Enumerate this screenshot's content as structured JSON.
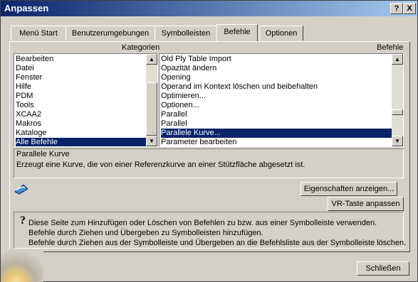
{
  "window": {
    "title": "Anpassen",
    "help_btn": "?",
    "close_btn": "X"
  },
  "tabs": [
    {
      "label": "Menü Start"
    },
    {
      "label": "Benutzerumgebungen"
    },
    {
      "label": "Symbolleisten"
    },
    {
      "label": "Befehle",
      "active": true
    },
    {
      "label": "Optionen"
    }
  ],
  "categories": {
    "header": "Kategorien",
    "items": [
      "Bearbeiten",
      "Datei",
      "Fenster",
      "Hilfe",
      "PDM",
      "Tools",
      "XCAA2",
      "Makros",
      "Kataloge",
      "Alle Befehle"
    ],
    "selected_index": 9
  },
  "commands": {
    "header": "Befehle",
    "items": [
      "Old Ply Table Import",
      "Opazität ändern",
      "Opening",
      "Operand im Kontext löschen und beibehalten",
      "Optimieren...",
      "Optionen...",
      "Parallel",
      "Parallel",
      "Parallele Kurve...",
      "Parameter bearbeiten"
    ],
    "selected_index": 8
  },
  "description": {
    "title": "Parallele Kurve",
    "text": "Erzeugt eine Kurve, die von einer Referenzkurve an einer Stützfläche abgesetzt ist."
  },
  "buttons": {
    "properties": "Eigenschaften anzeigen...",
    "vr_key": "VR-Taste anpassen",
    "close": "Schließen"
  },
  "help": {
    "line1": "Diese Seite zum Hinzufügen oder Löschen von Befehlen zu bzw. aus einer Symbolleiste verwenden.",
    "line2": "Befehle durch Ziehen und Übergeben zu Symbolleisten hinzufügen.",
    "line3": "Befehle durch Ziehen aus der Symbolleiste und Übergeben an die Befehlsliste aus der Symbolleiste löschen."
  }
}
